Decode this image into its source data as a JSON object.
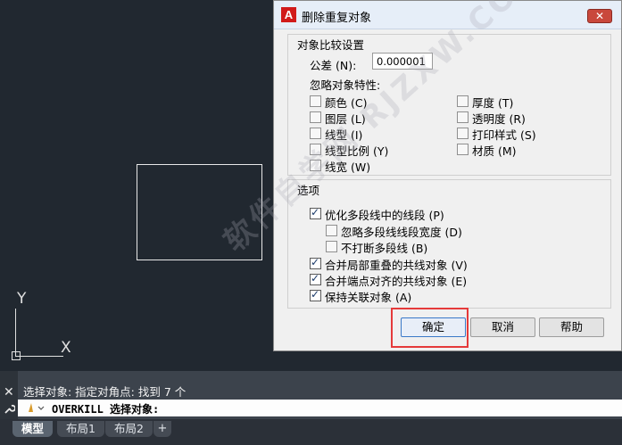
{
  "canvas": {
    "ucs": {
      "y_label": "Y",
      "x_label": "X"
    }
  },
  "dialog": {
    "title": "删除重复对象",
    "logo_letter": "A",
    "close_icon": "✕",
    "compare_group": {
      "title": "对象比较设置",
      "tolerance_label": "公差 (N):",
      "tolerance_value": "0.000001",
      "ignore_label": "忽略对象特性:",
      "properties_left": [
        {
          "label": "颜色 (C)",
          "checked": false
        },
        {
          "label": "图层 (L)",
          "checked": false
        },
        {
          "label": "线型 (I)",
          "checked": false
        },
        {
          "label": "线型比例 (Y)",
          "checked": false
        },
        {
          "label": "线宽 (W)",
          "checked": false
        }
      ],
      "properties_right": [
        {
          "label": "厚度 (T)",
          "checked": false
        },
        {
          "label": "透明度 (R)",
          "checked": false
        },
        {
          "label": "打印样式 (S)",
          "checked": false
        },
        {
          "label": "材质 (M)",
          "checked": false
        }
      ]
    },
    "options_group": {
      "title": "选项",
      "optimize": {
        "label": "优化多段线中的线段 (P)",
        "checked": true
      },
      "ignore_width": {
        "label": "忽略多段线线段宽度 (D)",
        "checked": false
      },
      "no_break": {
        "label": "不打断多段线 (B)",
        "checked": false
      },
      "merge_overlap": {
        "label": "合并局部重叠的共线对象 (V)",
        "checked": true
      },
      "merge_endpoint": {
        "label": "合并端点对齐的共线对象 (E)",
        "checked": true
      },
      "keep_assoc": {
        "label": "保持关联对象 (A)",
        "checked": true
      }
    },
    "buttons": {
      "ok": "确定",
      "cancel": "取消",
      "help": "帮助"
    }
  },
  "command": {
    "history": "选择对象: 指定对角点: 找到 7 个",
    "input": "OVERKILL 选择对象:",
    "close_icon": "✕",
    "wrench_icon": "🔧"
  },
  "tabs": [
    "模型",
    "布局1",
    "布局2"
  ],
  "tab_add": "+",
  "watermark": "软件自学网 RJZXW.COM",
  "colors": {
    "canvas_bg": "#212830",
    "highlight": "#e53a3a",
    "logo_red": "#d11a1a"
  }
}
